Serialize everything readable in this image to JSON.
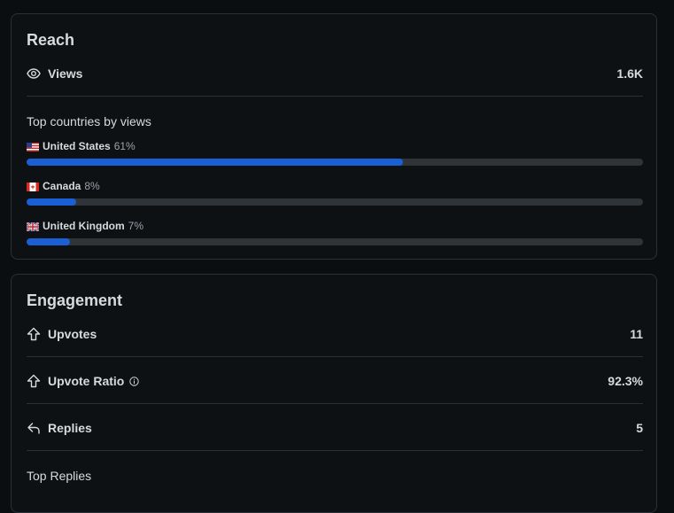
{
  "reach": {
    "title": "Reach",
    "views": {
      "icon": "eye-icon",
      "label": "Views",
      "value": "1.6K"
    },
    "top_countries_heading": "Top countries by views",
    "countries": [
      {
        "flag": "us-flag",
        "name": "United States",
        "percent_label": "61%",
        "percent": 61
      },
      {
        "flag": "ca-flag",
        "name": "Canada",
        "percent_label": "8%",
        "percent": 8
      },
      {
        "flag": "uk-flag",
        "name": "United Kingdom",
        "percent_label": "7%",
        "percent": 7
      }
    ]
  },
  "engagement": {
    "title": "Engagement",
    "upvotes": {
      "icon": "upvote-icon",
      "label": "Upvotes",
      "value": "11"
    },
    "upvote_ratio": {
      "icon": "upvote-icon",
      "label": "Upvote Ratio",
      "value": "92.3%",
      "info_icon": "info-icon"
    },
    "replies": {
      "icon": "reply-icon",
      "label": "Replies",
      "value": "5"
    },
    "top_replies_heading": "Top Replies"
  },
  "colors": {
    "background": "#0b0e11",
    "card_border": "#2b3036",
    "bar_fill": "#1a5fd4",
    "bar_track": "#2f3438"
  }
}
